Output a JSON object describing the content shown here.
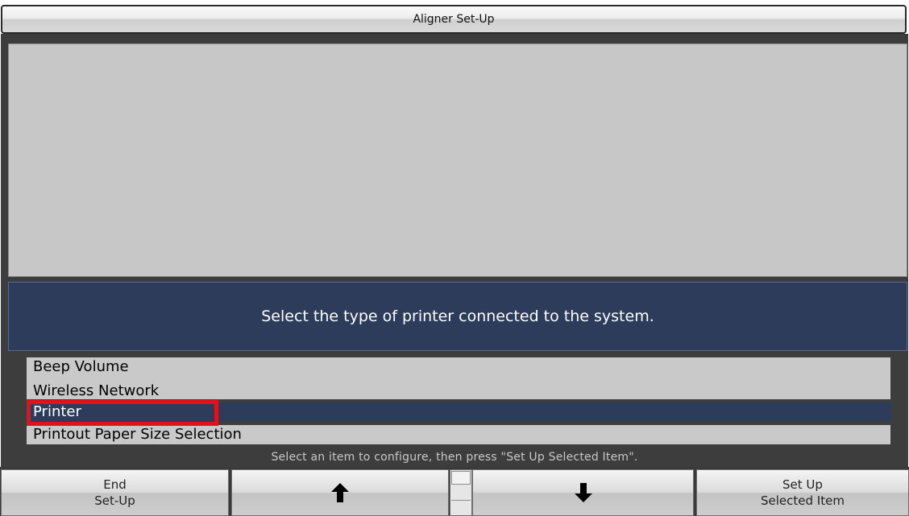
{
  "window": {
    "title": "Aligner Set-Up"
  },
  "info_panel": {
    "message": "Select the type of printer connected to the system."
  },
  "setup_list": {
    "items": [
      {
        "label": "Beep Volume",
        "selected": false
      },
      {
        "label": "Wireless Network",
        "selected": false
      },
      {
        "label": "Printer",
        "selected": true
      },
      {
        "label": "Printout Paper Size Selection",
        "selected": false
      }
    ],
    "highlight_color": "#e4101a",
    "selected_background": "#2e3c5c"
  },
  "hint": {
    "text": "Select an item to configure, then press \"Set Up Selected Item\"."
  },
  "buttons": {
    "end_setup": "End\nSet-Up",
    "up_icon": "arrow-up-icon",
    "down_icon": "arrow-down-icon",
    "setup_selected": "Set Up\nSelected Item"
  },
  "colors": {
    "panel_blue": "#2e3c5c",
    "panel_gray": "#c7c7c7",
    "frame_dark": "#3d3d3d"
  }
}
